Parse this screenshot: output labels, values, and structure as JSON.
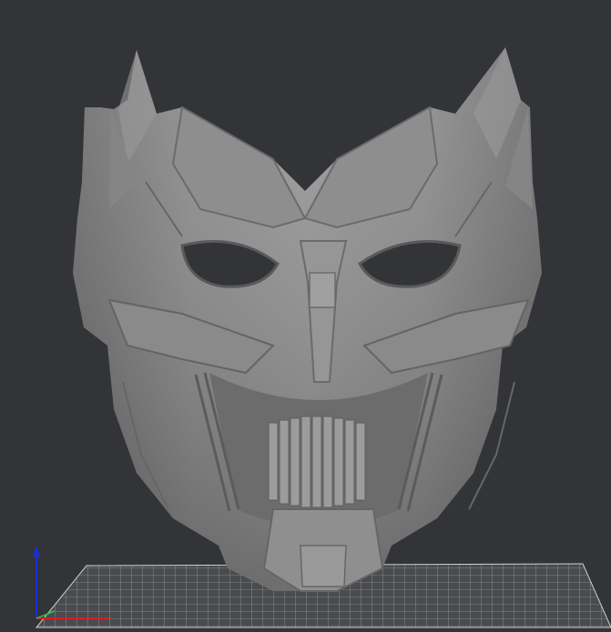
{
  "viewport": {
    "background": "#333437",
    "object": "3d-mask-model",
    "object_color": "#7c7c7c",
    "build_plate_grid_color": "#b9b9b9",
    "axes": {
      "x_color": "#d62020",
      "y_color": "#1fbf4a",
      "z_color": "#1530d8"
    }
  }
}
